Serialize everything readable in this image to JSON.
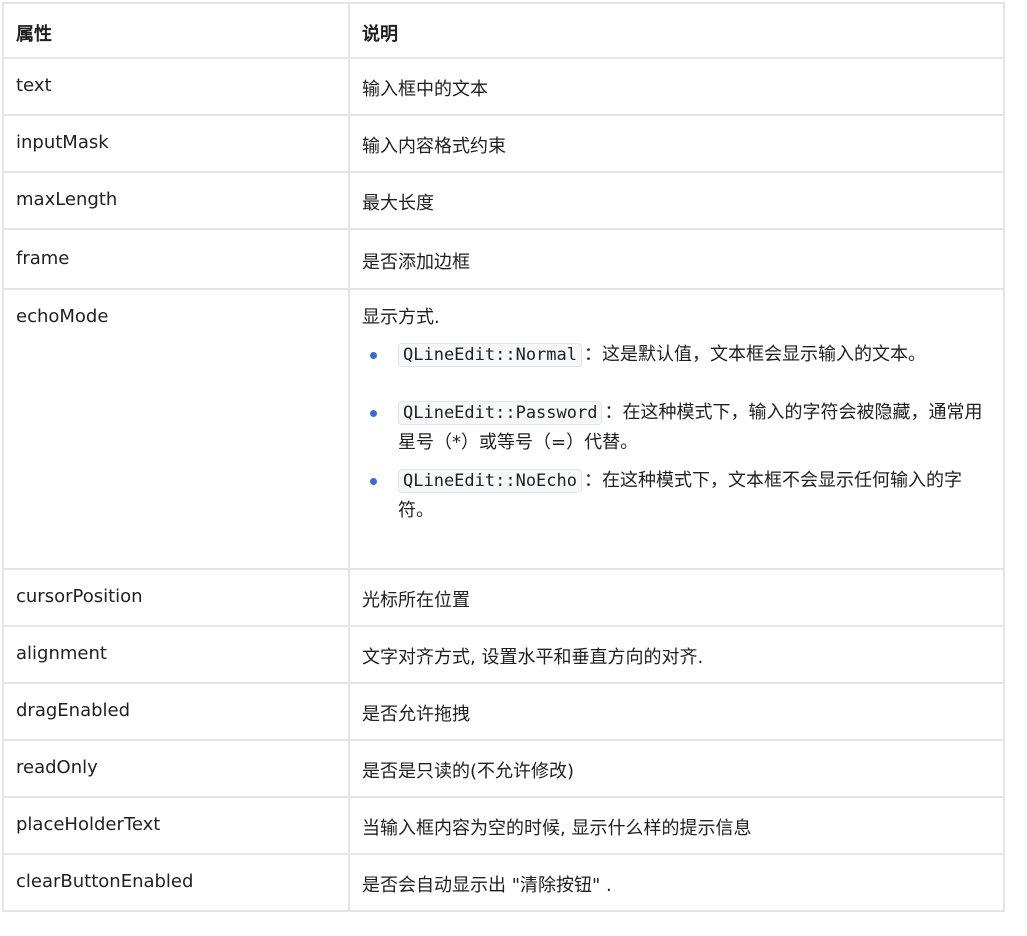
{
  "table": {
    "headers": {
      "property": "属性",
      "description": "说明"
    },
    "rows": [
      {
        "property": "text",
        "description": "输入框中的文本"
      },
      {
        "property": "inputMask",
        "description": "输入内容格式约束"
      },
      {
        "property": "maxLength",
        "description": "最大长度"
      },
      {
        "property": "frame",
        "description": "是否添加边框"
      },
      {
        "property": "echoMode",
        "description": "显示方式."
      },
      {
        "property": "cursorPosition",
        "description": "光标所在位置"
      },
      {
        "property": "alignment",
        "description": "文字对齐方式, 设置水平和垂直方向的对齐."
      },
      {
        "property": "dragEnabled",
        "description": "是否允许拖拽"
      },
      {
        "property": "readOnly",
        "description": "是否是只读的(不允许修改)"
      },
      {
        "property": "placeHolderText",
        "description": "当输入框内容为空的时候, 显示什么样的提示信息"
      },
      {
        "property": "clearButtonEnabled",
        "description": "是否会自动显示出 \"清除按钮\" ."
      }
    ],
    "echo_modes": [
      {
        "code": "QLineEdit::Normal",
        "text": "：这是默认值，文本框会显示输入的文本。"
      },
      {
        "code": "QLineEdit::Password",
        "text": "：在这种模式下，输入的字符会被隐藏，通常用星号（*）或等号（=）代替。"
      },
      {
        "code": "QLineEdit::NoEcho",
        "text": "：在这种模式下，文本框不会显示任何输入的字符。"
      }
    ]
  },
  "colors": {
    "border": "#e5e5e5",
    "bullet": "#2f6fd6",
    "code_bg": "#f6f7f9"
  }
}
